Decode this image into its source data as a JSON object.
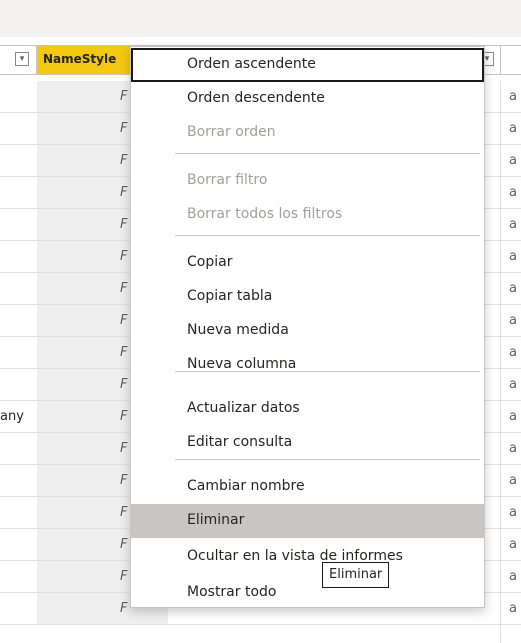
{
  "table": {
    "header": {
      "selected_column_label": "NameStyle",
      "filter_glyph": "▾"
    },
    "rows": [
      {
        "namestyle": "F",
        "right": "a"
      },
      {
        "namestyle": "F",
        "right": "a"
      },
      {
        "namestyle": "F",
        "right": "a"
      },
      {
        "namestyle": "F",
        "right": "a"
      },
      {
        "namestyle": "F",
        "right": "a"
      },
      {
        "namestyle": "F",
        "right": "a"
      },
      {
        "namestyle": "F",
        "right": "a"
      },
      {
        "namestyle": "F",
        "right": "a"
      },
      {
        "namestyle": "F",
        "right": "a"
      },
      {
        "namestyle": "F",
        "right": "a"
      },
      {
        "namestyle": "F",
        "right": "a",
        "left": "any"
      },
      {
        "namestyle": "F",
        "right": "a"
      },
      {
        "namestyle": "F",
        "right": "a"
      },
      {
        "namestyle": "F",
        "right": "a"
      },
      {
        "namestyle": "F",
        "right": "a"
      },
      {
        "namestyle": "F",
        "right": "a"
      },
      {
        "namestyle": "F",
        "right": "a"
      }
    ]
  },
  "context_menu": {
    "items": [
      {
        "label": "Orden ascendente",
        "state": "focused"
      },
      {
        "label": "Orden descendente",
        "state": "enabled"
      },
      {
        "label": "Borrar orden",
        "state": "disabled"
      },
      {
        "label": "Borrar filtro",
        "state": "disabled"
      },
      {
        "label": "Borrar todos los filtros",
        "state": "disabled"
      },
      {
        "label": "Copiar",
        "state": "enabled"
      },
      {
        "label": "Copiar tabla",
        "state": "enabled"
      },
      {
        "label": "Nueva medida",
        "state": "enabled"
      },
      {
        "label": "Nueva columna",
        "state": "enabled"
      },
      {
        "label": "Actualizar datos",
        "state": "enabled"
      },
      {
        "label": "Editar consulta",
        "state": "enabled"
      },
      {
        "label": "Cambiar nombre",
        "state": "enabled"
      },
      {
        "label": "Eliminar",
        "state": "hover"
      },
      {
        "label": "Ocultar en la vista de informes",
        "state": "enabled"
      },
      {
        "label": "Mostrar todo",
        "state": "enabled"
      }
    ]
  },
  "tooltip": {
    "text": "Eliminar"
  },
  "colors": {
    "selected_header": "#f2c811",
    "menu_hover": "#c8c6c4",
    "disabled_text": "#a19f9d"
  },
  "icons": {
    "filter": "chevron-down-icon"
  }
}
